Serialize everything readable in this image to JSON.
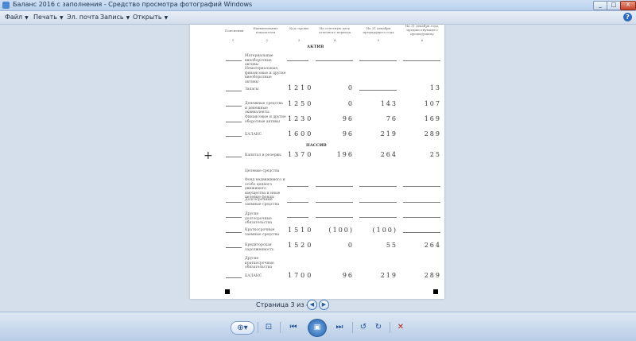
{
  "window": {
    "title": "Баланс 2016 с заполнения - Средство просмотра фотографий Windows",
    "minimize_icon": "minimize-icon",
    "maximize_icon": "maximize-icon",
    "close_icon": "close-icon"
  },
  "menu": {
    "items": [
      {
        "label": "Файл"
      },
      {
        "label": "Печать"
      },
      {
        "label": "Эл. почта"
      },
      {
        "label": "Запись"
      },
      {
        "label": "Открыть"
      }
    ],
    "dropdown_glyph": "▼",
    "help_glyph": "?"
  },
  "document": {
    "header": {
      "col1": "Пояснения",
      "col2": "Наименование показателя",
      "col3": "Код строки",
      "col4": "На отчетную дату отчетного периода",
      "col5": "На 31 декабря предыдущего года",
      "col6": "На 31 декабря года, предшествующего предыдущему",
      "n1": "1",
      "n2": "2",
      "n3": "3",
      "n4": "4",
      "n5": "5",
      "n6": "6"
    },
    "section_assets": "АКТИВ",
    "section_liabilities": "ПАССИВ",
    "rows": [
      {
        "label": "Материальные внеоборотные активы",
        "code": "",
        "v1": "",
        "v2": "",
        "v3": ""
      },
      {
        "label": "Нематериальные, финансовые и другие внеоборотные активы",
        "code": "",
        "v1": "",
        "v2": "",
        "v3": ""
      },
      {
        "label": "Запасы",
        "code": "1210",
        "v1": "0",
        "v2": "",
        "v3": "13"
      },
      {
        "label": "Денежные средства и денежные эквиваленты",
        "code": "1250",
        "v1": "0",
        "v2": "143",
        "v3": "107"
      },
      {
        "label": "Финансовые и другие оборотные активы",
        "code": "1230",
        "v1": "96",
        "v2": "76",
        "v3": "169"
      },
      {
        "label": "БАЛАНС",
        "code": "1600",
        "v1": "96",
        "v2": "219",
        "v3": "289"
      },
      {
        "label": "Капитал и резервы",
        "code": "1370",
        "v1": "196",
        "v2": "264",
        "v3": "25"
      },
      {
        "label": "Целевые средства",
        "code": "",
        "v1": "",
        "v2": "",
        "v3": ""
      },
      {
        "label": "Фонд недвижимого и особо ценного движимого имущества и иные целевые фонды",
        "code": "",
        "v1": "",
        "v2": "",
        "v3": ""
      },
      {
        "label": "Долгосрочные заемные средства",
        "code": "",
        "v1": "",
        "v2": "",
        "v3": ""
      },
      {
        "label": "Другие долгосрочные обязательства",
        "code": "",
        "v1": "",
        "v2": "",
        "v3": ""
      },
      {
        "label": "Краткосрочные заемные средства",
        "code": "1510",
        "v1": "(100)",
        "v2": "(100)",
        "v3": ""
      },
      {
        "label": "Кредиторская задолженность",
        "code": "1520",
        "v1": "0",
        "v2": "55",
        "v3": "264"
      },
      {
        "label": "Другие краткосрочные обязательства",
        "code": "",
        "v1": "",
        "v2": "",
        "v3": ""
      },
      {
        "label": "БАЛАНС",
        "code": "1700",
        "v1": "96",
        "v2": "219",
        "v3": "289"
      }
    ]
  },
  "pager": {
    "text": "Страница 3 из 4",
    "prev_glyph": "◀",
    "next_glyph": "▶"
  },
  "toolbar": {
    "zoom_glyph": "⊕▾",
    "fit_glyph": "⊡",
    "prev_glyph": "⏮",
    "slideshow_glyph": "▣",
    "next_glyph": "⏭",
    "rotate_ccw_glyph": "↺",
    "rotate_cw_glyph": "↻",
    "delete_glyph": "✕"
  }
}
